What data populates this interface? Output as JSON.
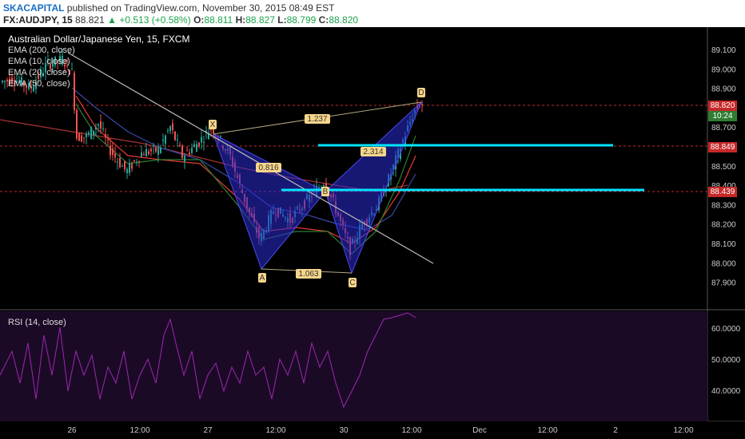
{
  "header": {
    "brand": "SKACAPITAL",
    "published": "published on TradingView.com, November 30, 2015 08:49 EST",
    "symbol": "FX:AUDJPY, 15",
    "last": "88.821",
    "change": "+0.513 (+0.58%)",
    "o_label": "O:",
    "o_value": "88.811",
    "h_label": "H:",
    "h_value": "88.827",
    "l_label": "L:",
    "l_value": "88.799",
    "c_label": "C:",
    "c_value": "88.820"
  },
  "legend": {
    "title": "Australian Dollar/Japanese Yen, 15, FXCM",
    "ema200": "EMA (200, close)",
    "ema10": "EMA (10, close)",
    "ema20": "EMA (20, close)",
    "ema50": "EMA (50, close)"
  },
  "rsi_label": "RSI (14, close)",
  "price_tags": {
    "current": "88.820",
    "timer": "10:24",
    "level_a": "88.849",
    "level_b": "88.439"
  },
  "chart_data": {
    "type": "candlestick",
    "price_axis": [
      "89.100",
      "89.000",
      "88.900",
      "88.800",
      "88.700",
      "88.600",
      "88.500",
      "88.400",
      "88.300",
      "88.200",
      "88.100",
      "88.000",
      "87.900"
    ],
    "rsi_axis": [
      "60.0000",
      "50.0000",
      "40.0000"
    ],
    "time_axis": [
      "26",
      "12:00",
      "27",
      "12:00",
      "30",
      "12:00",
      "Dec",
      "12:00",
      "2",
      "12:00"
    ],
    "ylim": [
      87.9,
      89.15
    ],
    "pattern": {
      "points": {
        "X": {
          "label": "X",
          "price": 88.72
        },
        "A": {
          "label": "A",
          "price": 88.08
        },
        "B": {
          "label": "B",
          "price": 88.42
        },
        "C": {
          "label": "C",
          "price": 88.05
        },
        "D": {
          "label": "D",
          "price": 88.84
        }
      },
      "ratios": {
        "xb": "0.816",
        "ac": "1.063",
        "bd": "2.314",
        "xd": "1.237"
      }
    },
    "levels": [
      88.849,
      88.439
    ],
    "colors": {
      "up": "#26a69a",
      "down": "#ef5350",
      "pattern": "#2a2ad4",
      "level": "#00e5ff",
      "rsi": "#9c27b0",
      "ema200": "#a83232",
      "ema10": "#2e7d32",
      "ema20": "#e53935",
      "ema50": "#3949ab"
    }
  }
}
